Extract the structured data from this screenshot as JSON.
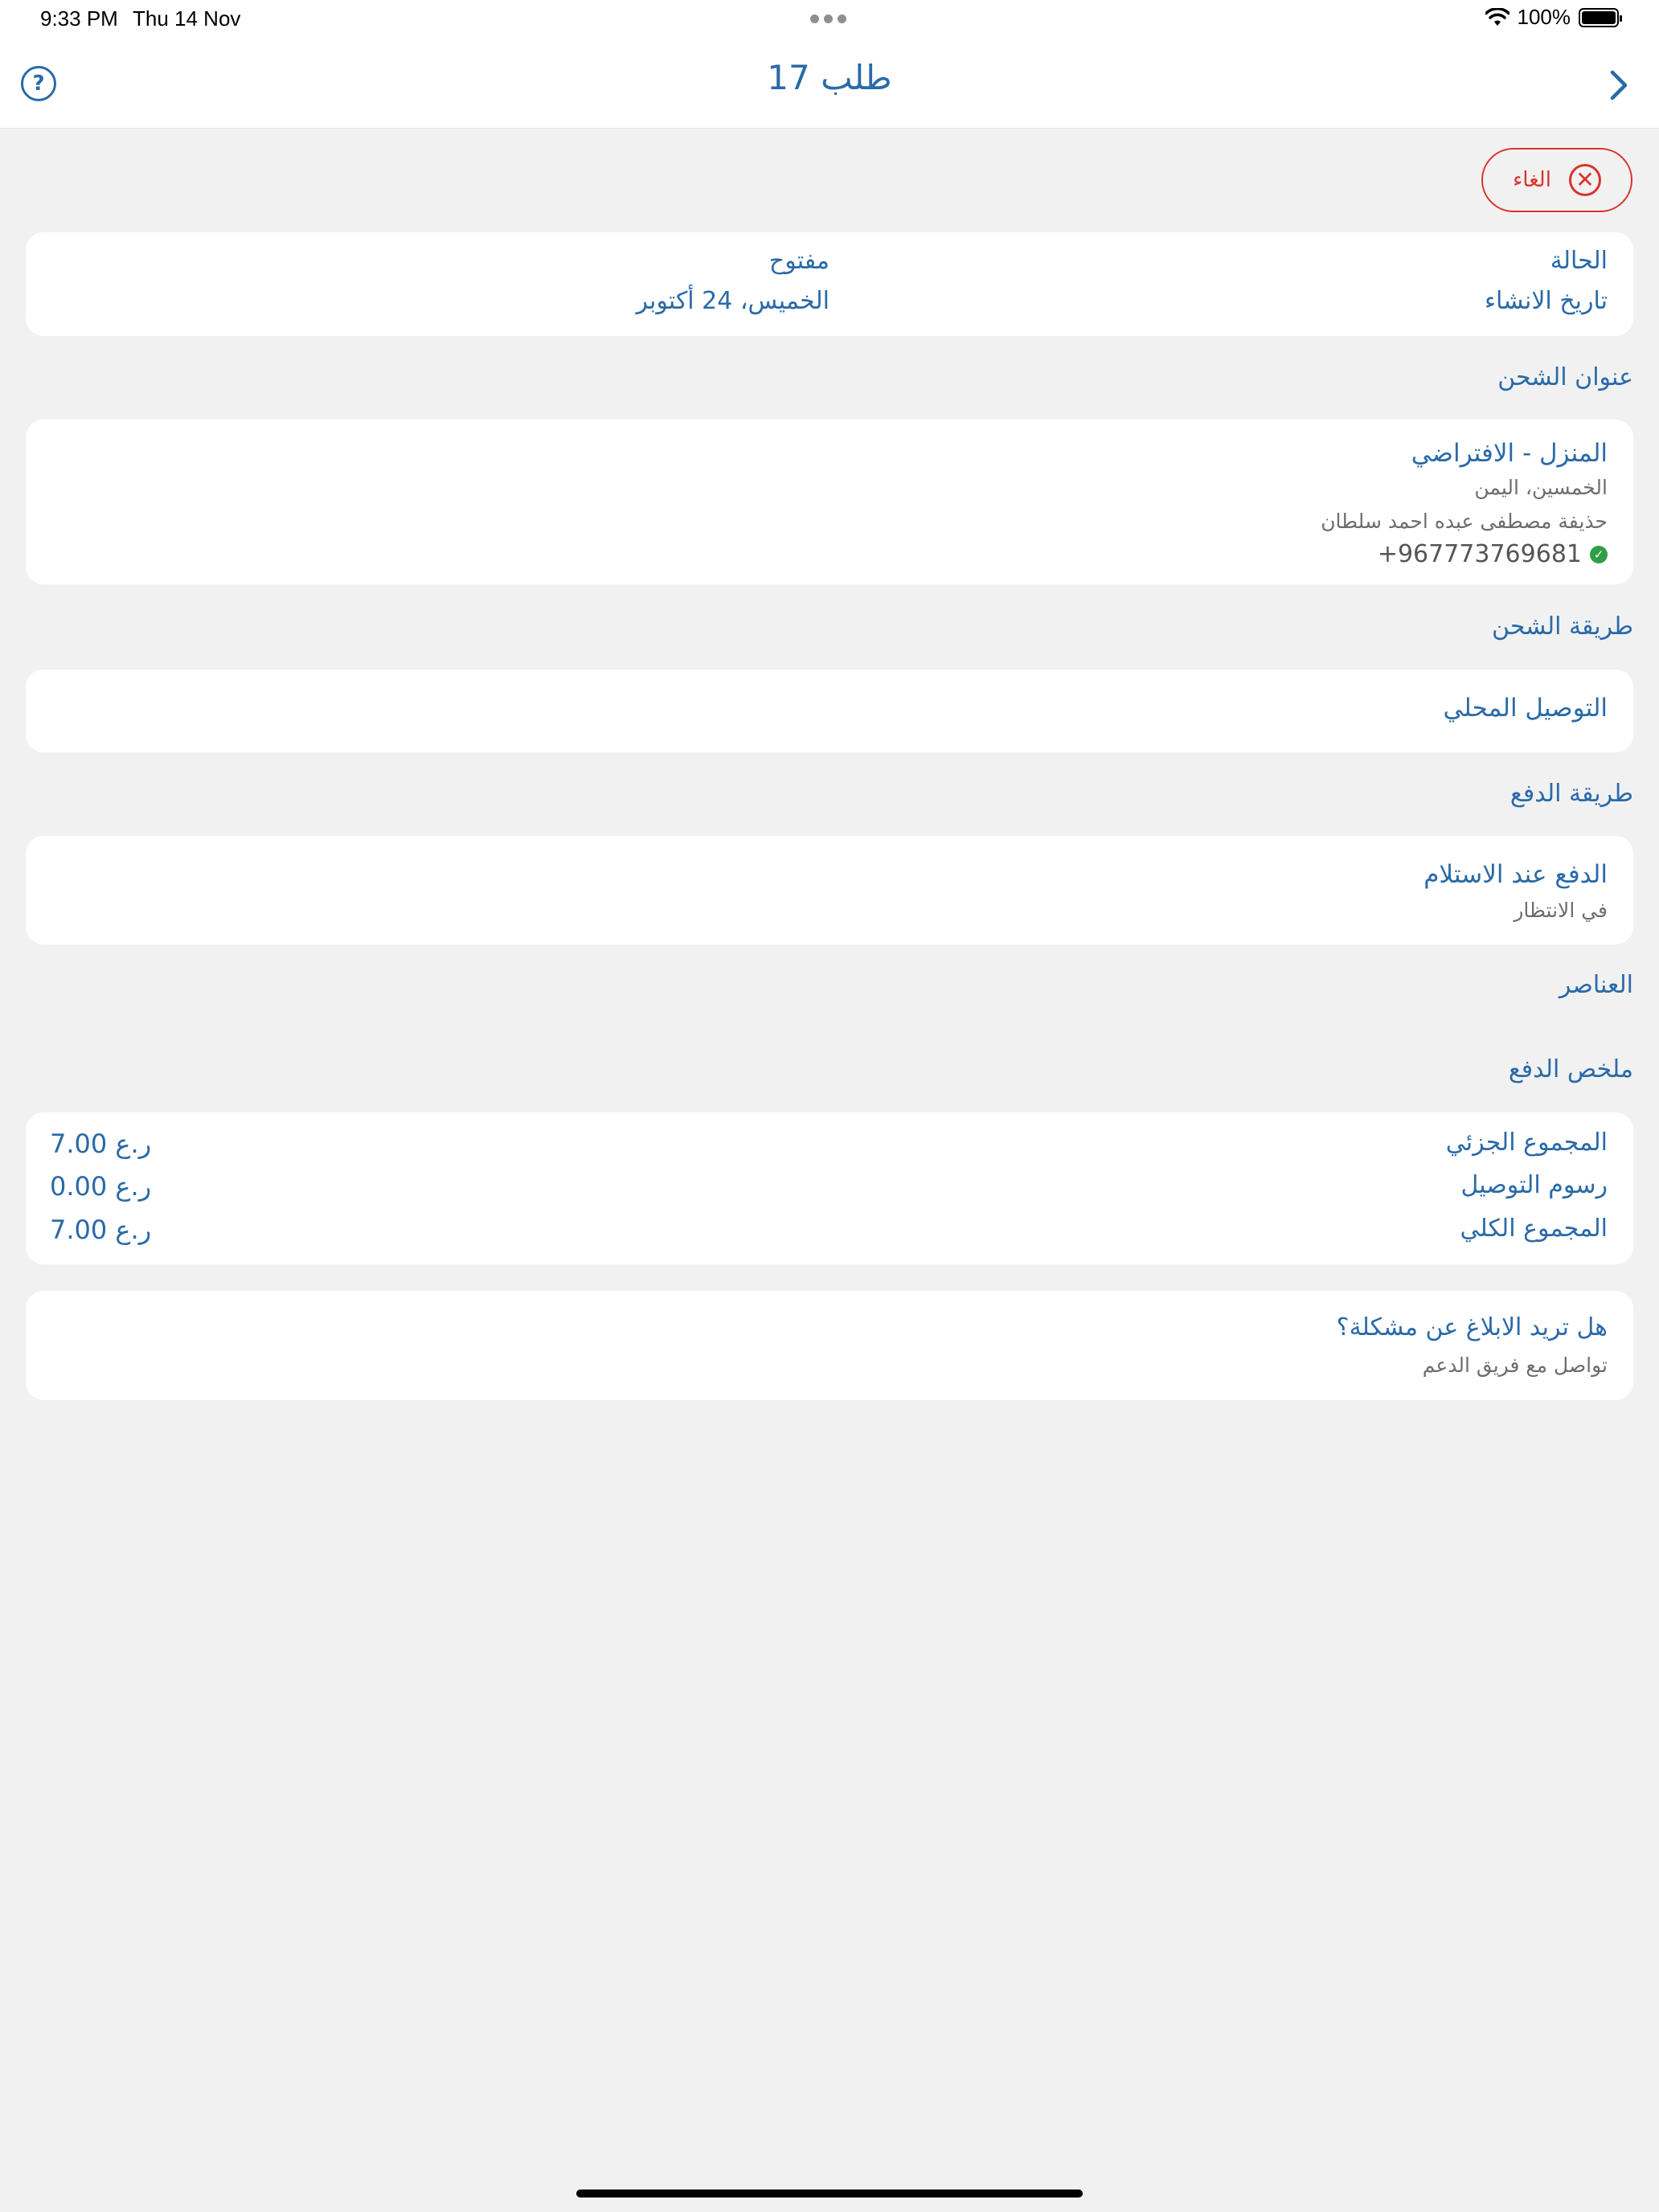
{
  "status_bar": {
    "time": "9:33 PM",
    "date": "Thu 14 Nov",
    "battery": "100%"
  },
  "nav": {
    "title": "طلب 17",
    "help_glyph": "?"
  },
  "cancel_button": {
    "label": "الغاء",
    "icon_glyph": "✕"
  },
  "order_info": {
    "status_label": "الحالة",
    "status_value": "مفتوح",
    "created_label": "تاريخ الانشاء",
    "created_value": "الخميس، 24 أكتوبر"
  },
  "shipping_address": {
    "title": "عنوان الشحن",
    "name": "المنزل - الافتراضي",
    "location": "الخمسين، اليمن",
    "recipient": "حذيفة مصطفى عبده احمد سلطان",
    "phone": "+967773769681",
    "check_glyph": "✓"
  },
  "shipping_method": {
    "title": "طريقة الشحن",
    "value": "التوصيل المحلي"
  },
  "payment_method": {
    "title": "طريقة الدفع",
    "value": "الدفع عند الاستلام",
    "status": "في الانتظار"
  },
  "items": {
    "title": "العناصر"
  },
  "payment_summary": {
    "title": "ملخص الدفع",
    "rows": [
      {
        "label": "المجموع الجزئي",
        "amount": "7.00 ر.ع"
      },
      {
        "label": "رسوم التوصيل",
        "amount": "0.00 ر.ع"
      },
      {
        "label": "المجموع الكلي",
        "amount": "7.00 ر.ع"
      }
    ]
  },
  "report": {
    "title": "هل تريد الابلاغ عن مشكلة؟",
    "subtitle": "تواصل مع فريق الدعم"
  },
  "icons": [
    "wifi-icon",
    "battery-icon",
    "help-icon",
    "chevron-right-icon",
    "cancel-icon",
    "verified-check-icon"
  ]
}
